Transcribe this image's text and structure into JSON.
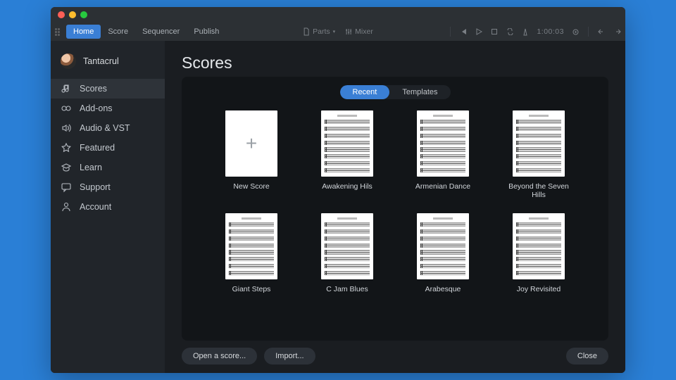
{
  "menubar": {
    "items": [
      "Home",
      "Score",
      "Sequencer",
      "Publish"
    ],
    "active_index": 0,
    "center": {
      "parts": "Parts",
      "mixer": "Mixer"
    },
    "timecode": "1:00:03"
  },
  "sidebar": {
    "user": "Tantacrul",
    "items": [
      {
        "icon": "music",
        "label": "Scores"
      },
      {
        "icon": "puzzle",
        "label": "Add-ons"
      },
      {
        "icon": "speaker",
        "label": "Audio & VST"
      },
      {
        "icon": "star",
        "label": "Featured"
      },
      {
        "icon": "grad",
        "label": "Learn"
      },
      {
        "icon": "chat",
        "label": "Support"
      },
      {
        "icon": "person",
        "label": "Account"
      }
    ],
    "active_index": 0
  },
  "page": {
    "title": "Scores",
    "tabs": [
      "Recent",
      "Templates"
    ],
    "active_tab": 0,
    "scores": [
      {
        "label": "New Score",
        "type": "new"
      },
      {
        "label": "Awakening Hils",
        "type": "sheet"
      },
      {
        "label": "Armenian Dance",
        "type": "sheet"
      },
      {
        "label": "Beyond the Seven Hills",
        "type": "sheet"
      },
      {
        "label": "Giant Steps",
        "type": "sheet"
      },
      {
        "label": "C Jam Blues",
        "type": "sheet"
      },
      {
        "label": "Arabesque",
        "type": "sheet"
      },
      {
        "label": "Joy Revisited",
        "type": "sheet"
      }
    ],
    "footer": {
      "open": "Open a score...",
      "import": "Import...",
      "close": "Close"
    }
  }
}
